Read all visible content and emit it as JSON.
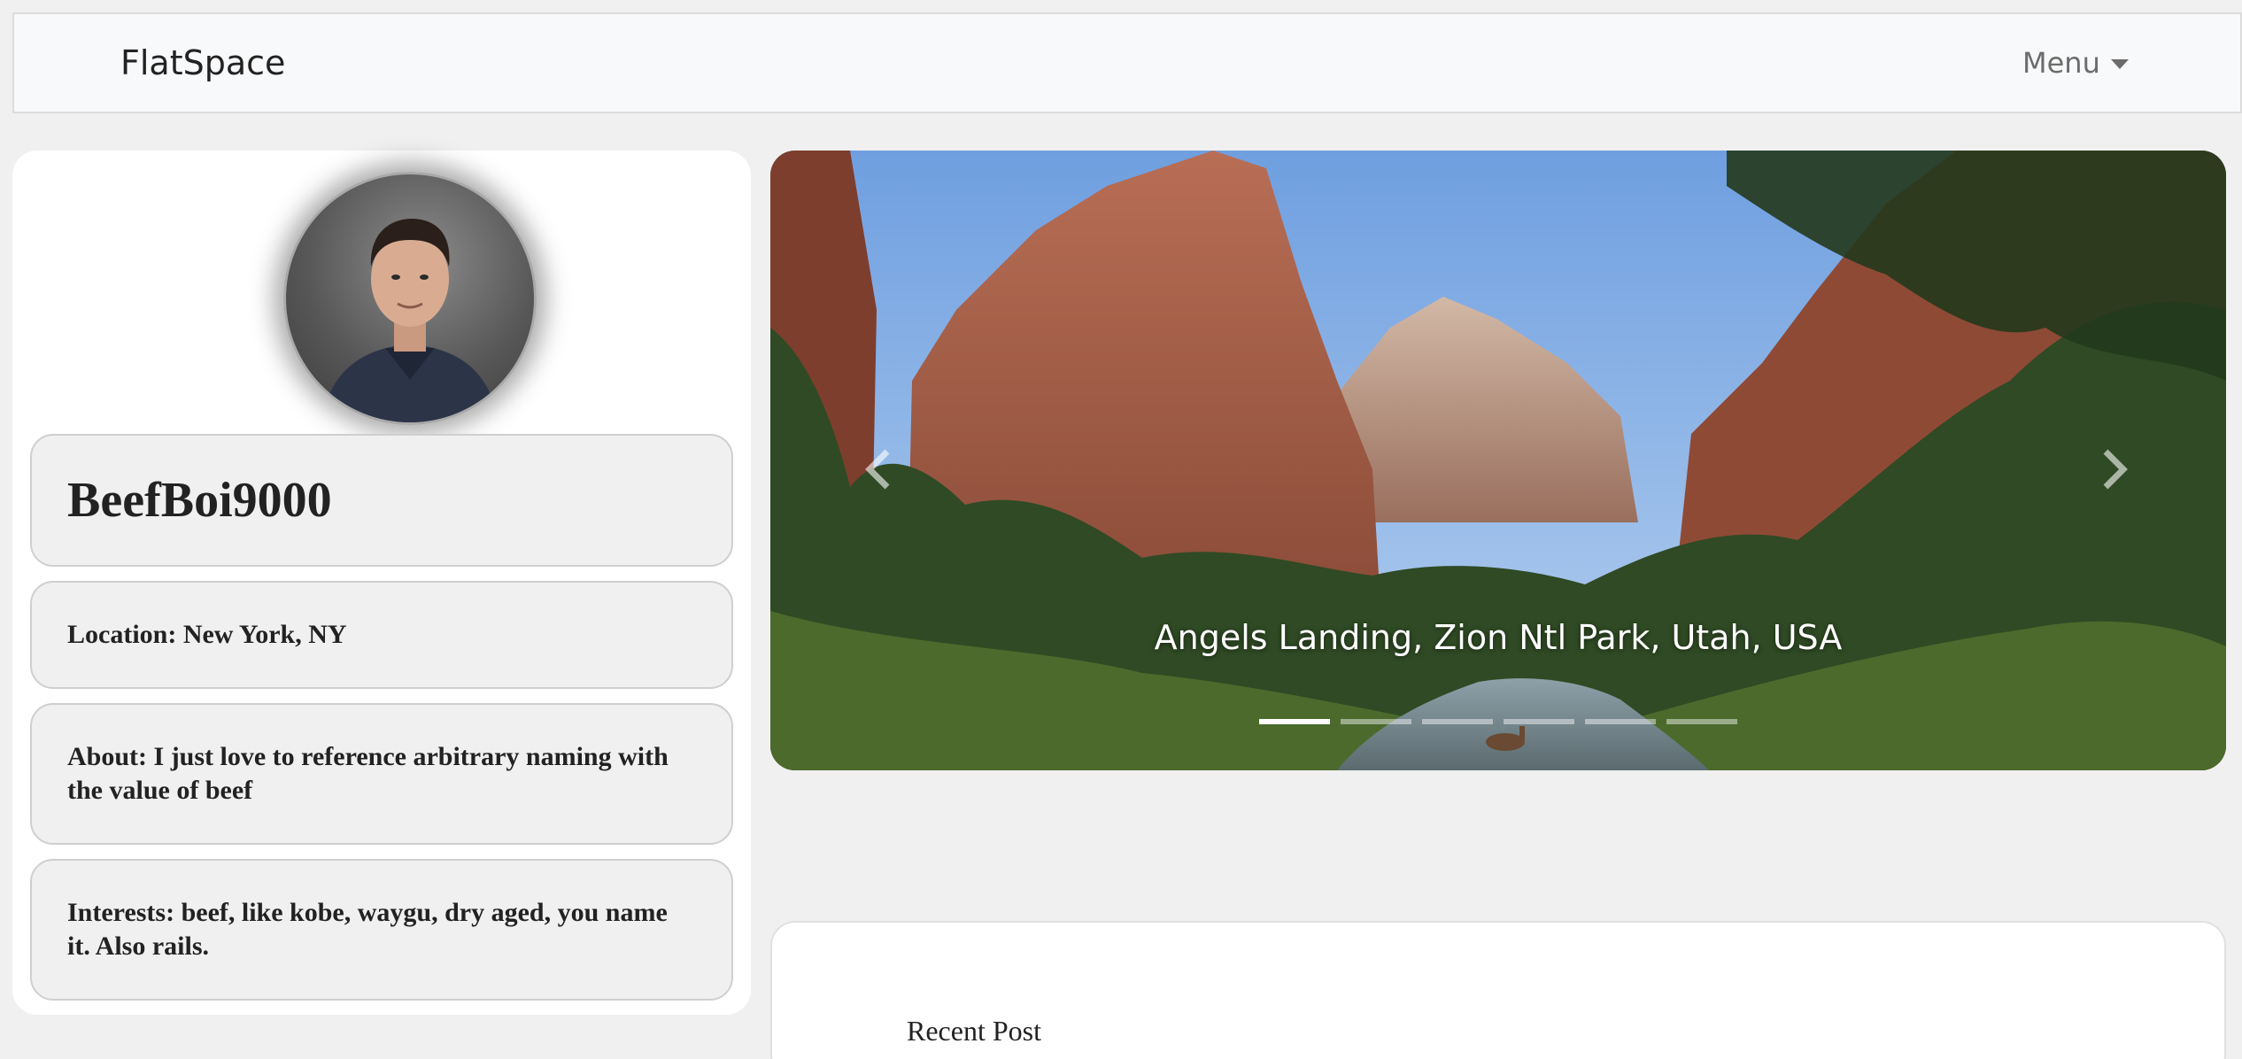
{
  "navbar": {
    "brand": "FlatSpace",
    "menu_label": "Menu"
  },
  "profile": {
    "username": "BeefBoi9000",
    "location": "Location: New York, NY",
    "about": "About: I just love to reference arbitrary naming with the value of beef",
    "interests": "Interests: beef, like kobe, waygu, dry aged, you name it. Also rails."
  },
  "carousel": {
    "caption": "Angels Landing, Zion Ntl Park, Utah, USA",
    "slide_count": 6,
    "active_slide": 1
  },
  "recent_post": {
    "title": "Recent Post"
  },
  "icons": {
    "prev": "chevron-left-icon",
    "next": "chevron-right-icon",
    "menu_caret": "caret-down-icon"
  }
}
